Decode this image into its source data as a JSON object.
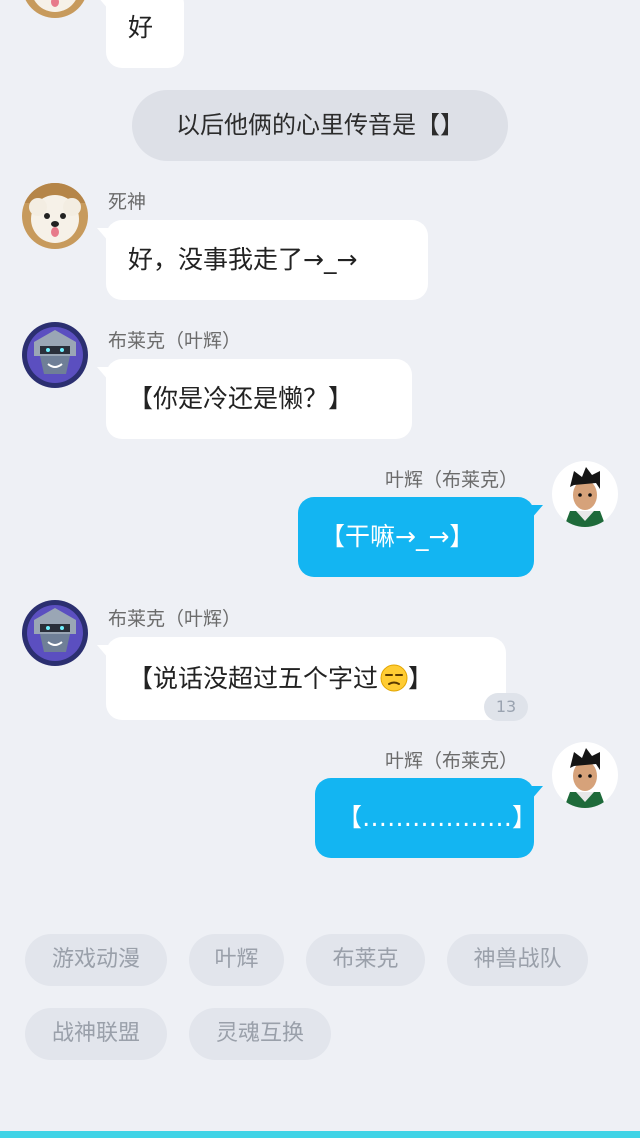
{
  "messages": [
    {
      "sender": "",
      "text": "好"
    },
    {
      "sender": "死神",
      "text": "好，没事我走了→_→"
    },
    {
      "sender": "布莱克（叶辉）",
      "text": "【你是冷还是懒？】"
    },
    {
      "sender": "叶辉（布莱克）",
      "text": "【干嘛→_→】"
    },
    {
      "sender": "布莱克（叶辉）",
      "text": "【说话没超过五个字过",
      "text_end": "】",
      "count": "13"
    },
    {
      "sender": "叶辉（布莱克）",
      "text": "【………………】"
    }
  ],
  "system_message": "以后他俩的心里传音是【】",
  "tags": [
    "游戏动漫",
    "叶辉",
    "布莱克",
    "神兽战队",
    "战神联盟",
    "灵魂互换"
  ],
  "colors": {
    "background": "#eef0f5",
    "incoming_bubble": "#ffffff",
    "outgoing_bubble": "#13b5f2",
    "tag_bg": "#e2e5ec",
    "tag_text": "#9aa0aa",
    "bottom_bar": "#40d3e6"
  },
  "icons": {
    "dog_avatar": "dog-avatar-icon",
    "robot_avatar": "robot-avatar-icon",
    "boy_avatar": "boy-avatar-icon",
    "unamused_emoji": "unamused-face-icon"
  }
}
